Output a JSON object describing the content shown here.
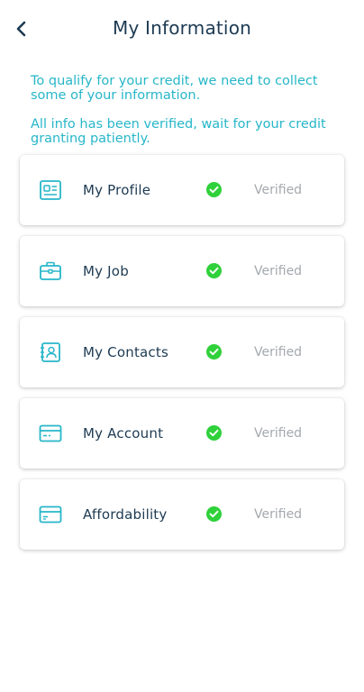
{
  "header": {
    "title": "My Information",
    "back_icon": "chevron-left-icon"
  },
  "intro": {
    "line1": "To qualify for your credit, we need to collect some of your information.",
    "line2": "All info has been verified, wait for your credit granting patiently."
  },
  "colors": {
    "accent": "#27b6c9",
    "text": "#1d3a52",
    "check": "#2fd13a",
    "muted": "#a4a8ad"
  },
  "items": [
    {
      "label": "My Profile",
      "status": "Verified",
      "icon": "id-card-icon"
    },
    {
      "label": "My Job",
      "status": "Verified",
      "icon": "briefcase-icon"
    },
    {
      "label": "My Contacts",
      "status": "Verified",
      "icon": "contacts-icon"
    },
    {
      "label": "My Account",
      "status": "Verified",
      "icon": "credit-card-icon"
    },
    {
      "label": "Affordability",
      "status": "Verified",
      "icon": "wallet-card-icon"
    }
  ]
}
